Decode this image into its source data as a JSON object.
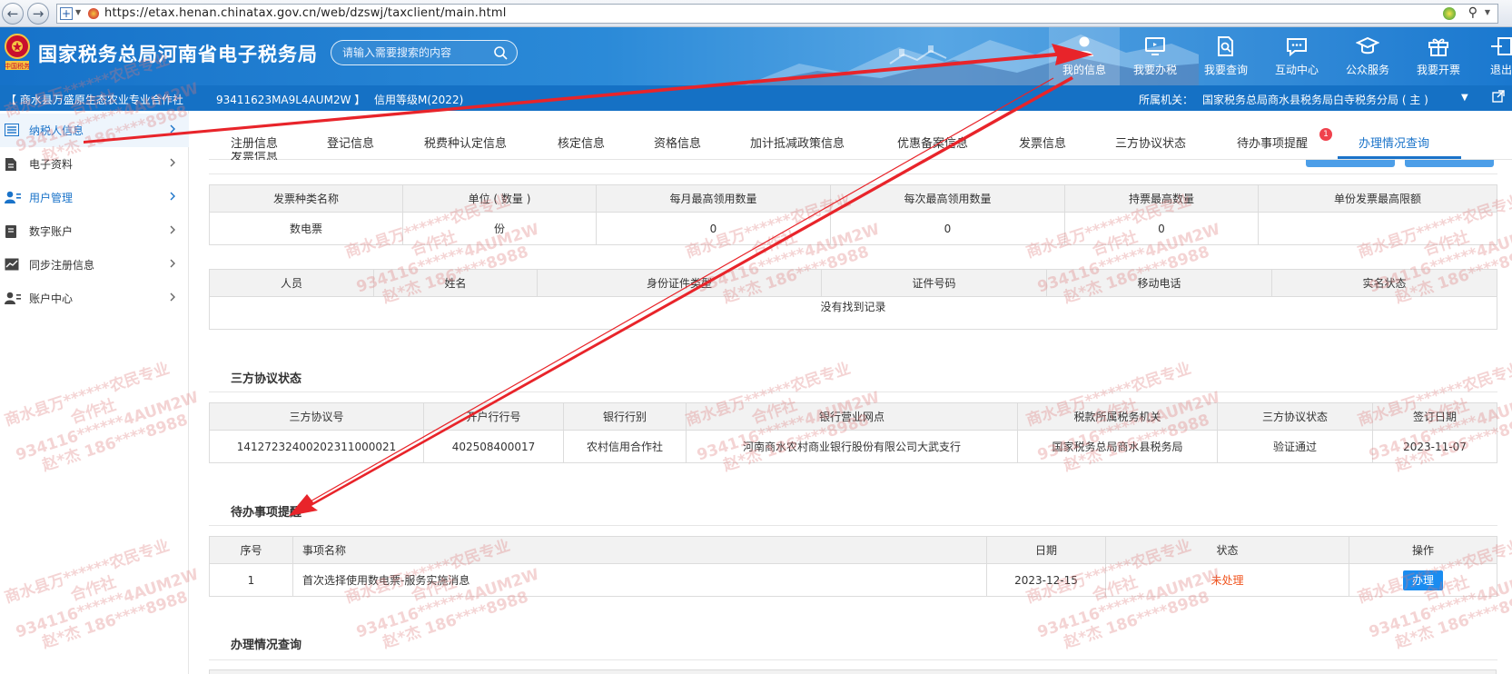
{
  "browser": {
    "url": "https://etax.henan.chinatax.gov.cn/web/dzswj/taxclient/main.html",
    "back_icon": "back-arrow-icon",
    "forward_icon": "forward-arrow-icon"
  },
  "header": {
    "site_title": "国家税务总局河南省电子税务局",
    "emblem_text": "中国税务",
    "search_placeholder": "请输入需要搜索的内容",
    "nav": [
      {
        "label": "我的信息",
        "icon": "user-icon"
      },
      {
        "label": "我要办税",
        "icon": "monitor-icon"
      },
      {
        "label": "我要查询",
        "icon": "document-search-icon"
      },
      {
        "label": "互动中心",
        "icon": "chat-icon"
      },
      {
        "label": "公众服务",
        "icon": "graduation-cap-icon"
      },
      {
        "label": "我要开票",
        "icon": "gift-box-icon"
      },
      {
        "label": "退出",
        "icon": "exit-icon"
      }
    ]
  },
  "infobar": {
    "company": "【 商水县万盛原生态农业专业合作社",
    "tax_id": "93411623MA9L4AUM2W 】",
    "credit": "信用等级M(2022)",
    "agency_label": "所属机关：",
    "agency": "国家税务总局商水县税务局白寺税务分局 ( 主 )"
  },
  "sidebar": {
    "items": [
      {
        "label": "纳税人信息",
        "icon": "list-icon"
      },
      {
        "label": "电子资料",
        "icon": "file-icon"
      },
      {
        "label": "用户管理",
        "icon": "user-manage-icon"
      },
      {
        "label": "数字账户",
        "icon": "book-icon"
      },
      {
        "label": "同步注册信息",
        "icon": "chart-line-icon"
      },
      {
        "label": "账户中心",
        "icon": "account-icon"
      }
    ]
  },
  "tabs": [
    "注册信息",
    "登记信息",
    "税费种认定信息",
    "核定信息",
    "资格信息",
    "加计抵减政策信息",
    "优惠备案信息",
    "发票信息",
    "三方协议状态",
    "待办事项提醒",
    "办理情况查询"
  ],
  "tab_badge": "1",
  "clipped_section_title": "发票信息",
  "invoice_table": {
    "headers": [
      "发票种类名称",
      "单位 ( 数量 )",
      "每月最高领用数量",
      "每次最高领用数量",
      "持票最高数量",
      "单份发票最高限额"
    ],
    "rows": [
      [
        "数电票",
        "份",
        "0",
        "0",
        "0",
        ""
      ]
    ]
  },
  "people_table": {
    "headers": [
      "人员",
      "姓名",
      "身份证件类型",
      "证件号码",
      "移动电话",
      "实名状态"
    ],
    "empty_text": "没有找到记录"
  },
  "tripartite": {
    "title": "三方协议状态",
    "headers": [
      "三方协议号",
      "开户行行号",
      "银行行别",
      "银行营业网点",
      "税款所属税务机关",
      "三方协议状态",
      "签订日期"
    ],
    "rows": [
      [
        "14127232400202311000021",
        "402508400017",
        "农村信用合作社",
        "河南商水农村商业银行股份有限公司大武支行",
        "国家税务总局商水县税务局",
        "验证通过",
        "2023-11-07"
      ]
    ]
  },
  "todo": {
    "title": "待办事项提醒",
    "headers": [
      "序号",
      "事项名称",
      "日期",
      "状态",
      "操作"
    ],
    "rows": [
      {
        "index": "1",
        "name": "首次选择使用数电票-服务实施消息",
        "date": "2023-12-15",
        "status": "未处理",
        "action": "办理"
      }
    ]
  },
  "progress_query": {
    "title": "办理情况查询"
  },
  "watermark": {
    "line1": "商水县万******农民专业",
    "line2": "合作社",
    "line3": "934116******4AUM2W",
    "line4": "赵*杰 186****8988"
  },
  "colors": {
    "header_blue": "#1672c9",
    "accent_blue": "#1a73c9",
    "annotation_red": "#e8242a",
    "status_orange": "#f0541e"
  }
}
